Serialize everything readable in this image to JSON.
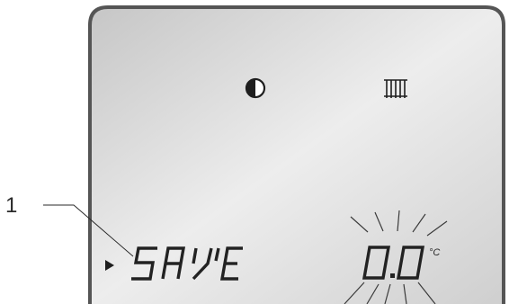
{
  "callout": {
    "label": "1"
  },
  "display": {
    "mode_icon": "half-moon-icon",
    "heating_icon": "radiator-icon",
    "pointer_icon": "triangle-pointer-icon",
    "message": "SAVE",
    "temperature": {
      "value": "0.0",
      "unit": "°C",
      "blinking": true
    }
  },
  "colors": {
    "lcd_light": "#f4f4f4",
    "lcd_dark": "#c9c9c9",
    "frame": "#555555",
    "segment": "#222222"
  }
}
